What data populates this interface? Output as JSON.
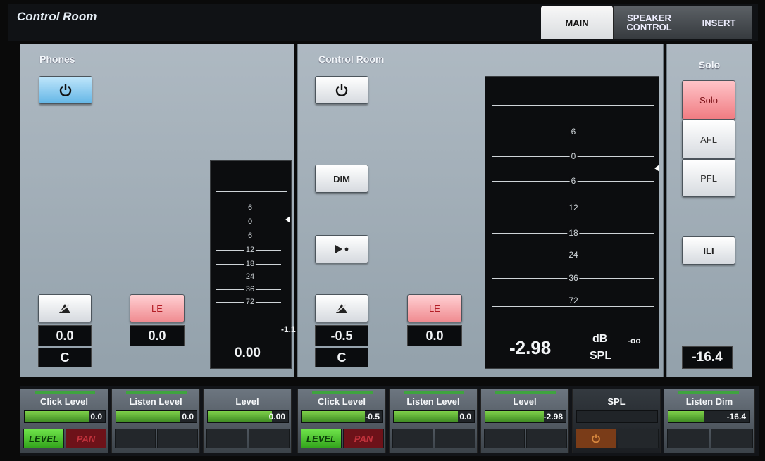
{
  "header": {
    "title": "Control Room",
    "tabs": [
      {
        "label": "MAIN",
        "active": true
      },
      {
        "label": "SPEAKER CONTROL",
        "active": false
      },
      {
        "label": "INSERT",
        "active": false
      }
    ]
  },
  "phones": {
    "label": "Phones",
    "power_icon": "power-icon",
    "le_label": "LE",
    "level_value": "0.0",
    "pan_value": "C",
    "le_value": "0.0",
    "meter": {
      "scale": [
        "6",
        "0",
        "6",
        "12",
        "18",
        "24",
        "36",
        "72"
      ],
      "peak": "-1.1",
      "value": "0.00"
    }
  },
  "control_room": {
    "label": "Control Room",
    "power_icon": "power-icon",
    "dim_label": "DIM",
    "play_icon": "play-dot-icon",
    "le_label": "LE",
    "level_value": "-0.5",
    "pan_value": "C",
    "le_value": "0.0",
    "meter": {
      "scale": [
        "6",
        "0",
        "6",
        "12",
        "18",
        "24",
        "36",
        "72"
      ],
      "value": "-2.98",
      "unit": "dB",
      "spl_label": "SPL",
      "peak": "-oo"
    }
  },
  "solo": {
    "label": "Solo",
    "buttons": [
      "Solo",
      "AFL",
      "PFL"
    ],
    "ili_label": "ILI",
    "value": "-16.4"
  },
  "bottom": {
    "cells": [
      {
        "title": "Click Level",
        "value": "0.0",
        "fill_pct": 80,
        "minis": [
          "LEVEL",
          "PAN"
        ]
      },
      {
        "title": "Listen Level",
        "value": "0.0",
        "fill_pct": 80,
        "minis": [
          "",
          ""
        ]
      },
      {
        "title": "Level",
        "value": "0.00",
        "fill_pct": 80,
        "minis": [
          "",
          ""
        ]
      },
      {
        "title": "Click Level",
        "value": "-0.5",
        "fill_pct": 78,
        "minis": [
          "LEVEL",
          "PAN"
        ]
      },
      {
        "title": "Listen Level",
        "value": "0.0",
        "fill_pct": 80,
        "minis": [
          "",
          ""
        ]
      },
      {
        "title": "Level",
        "value": "-2.98",
        "fill_pct": 73,
        "minis": [
          "",
          ""
        ]
      },
      {
        "title": "SPL",
        "value": "",
        "fill_pct": 0,
        "minis": [
          "power",
          ""
        ]
      },
      {
        "title": "Listen Dim",
        "value": "-16.4",
        "fill_pct": 45,
        "minis": [
          "",
          ""
        ]
      }
    ]
  },
  "colors": {
    "level_green": "#4caf2e",
    "pan_red": "#8a1620",
    "le_red": "#f08c91",
    "power_blue": "#64b6e6"
  }
}
